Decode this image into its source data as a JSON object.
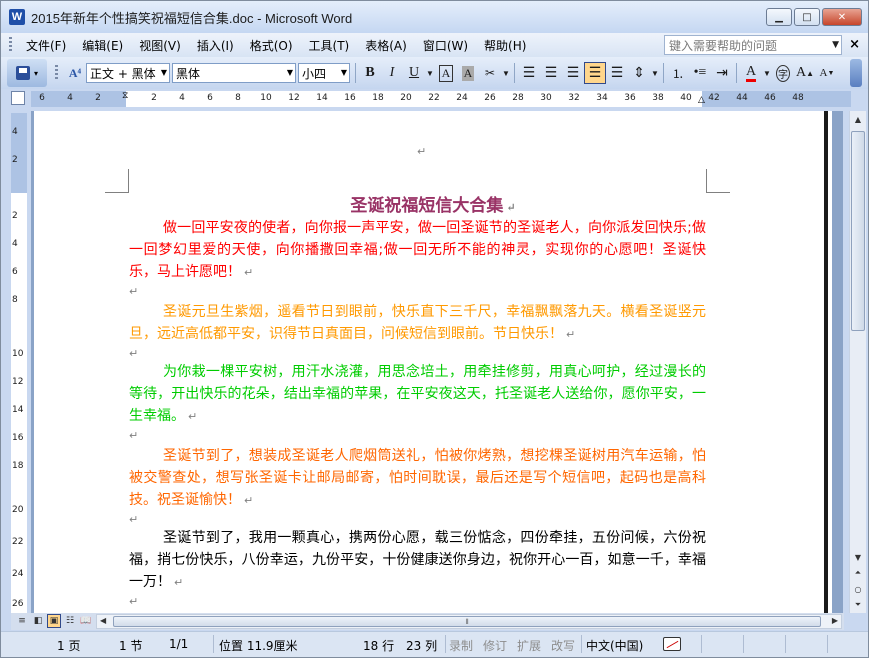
{
  "window": {
    "title": "2015年新年个性搞笑祝福短信合集.doc - Microsoft Word",
    "app_icon": "W",
    "controls": {
      "minimize_icon": "minimize-icon",
      "maximize_icon": "maximize-icon",
      "close_icon": "close-icon"
    }
  },
  "menu": {
    "items": [
      "文件(F)",
      "编辑(E)",
      "视图(V)",
      "插入(I)",
      "格式(O)",
      "工具(T)",
      "表格(A)",
      "窗口(W)",
      "帮助(H)"
    ],
    "help_placeholder": "键入需要帮助的问题",
    "doc_close": "×"
  },
  "toolbar": {
    "style_value": "正文 + 黑体",
    "font_value": "黑体",
    "size_value": "小四",
    "bold": "B",
    "italic": "I",
    "underline": "U",
    "char_border": "A",
    "char_shading": "A",
    "font_color": "A",
    "phonetic": "字",
    "grow_font": "A",
    "shrink_font": "A"
  },
  "ruler": {
    "horizontal": [
      "6",
      "4",
      "2",
      "2",
      "4",
      "6",
      "8",
      "10",
      "12",
      "14",
      "16",
      "18",
      "20",
      "22",
      "24",
      "26",
      "28",
      "30",
      "32",
      "34",
      "36",
      "38",
      "40",
      "42",
      "44",
      "46",
      "48"
    ],
    "vertical": [
      "4",
      "2",
      "2",
      "4",
      "6",
      "8",
      "10",
      "12",
      "14",
      "16",
      "18",
      "20",
      "22",
      "24",
      "26"
    ]
  },
  "document": {
    "title": "圣诞祝福短信大合集",
    "paragraph_mark": "↵",
    "paragraphs": [
      {
        "text": "做一回平安夜的使者，向你报一声平安，做一回圣诞节的圣诞老人，向你派发回快乐;做一回梦幻里爱的天使，向你播撒回幸福;做一回无所不能的神灵，实现你的心愿吧！圣诞快乐，马上许愿吧！",
        "color": "#ff0000"
      },
      {
        "text": "圣诞元旦生紫烟，遥看节日到眼前，快乐直下三千尺，幸福飘飘落九天。横看圣诞竖元旦，远近高低都平安，识得节日真面目，问候短信到眼前。节日快乐！",
        "color": "#ff9900"
      },
      {
        "text": "为你栽一棵平安树，用汗水浇灌，用思念培土，用牵挂修剪，用真心呵护，经过漫长的等待，开出快乐的花朵，结出幸福的苹果，在平安夜这天，托圣诞老人送给你，愿你平安，一生幸福。",
        "color": "#00cc00"
      },
      {
        "text": "圣诞节到了，想装成圣诞老人爬烟筒送礼，怕被你烤熟，想挖棵圣诞树用汽车运输，怕被交警查处，想写张圣诞卡让邮局邮寄，怕时间耽误，最后还是写个短信吧，起码也是高科技。祝圣诞愉快！",
        "color": "#ff6600"
      },
      {
        "text": "圣诞节到了，我用一颗真心，携两份心愿，载三份惦念，四份牵挂，五份问候，六份祝福，捎七份快乐，八份幸运，九份平安，十份健康送你身边，祝你开心一百，如意一千，幸福一万！",
        "color": "#000000"
      }
    ]
  },
  "statusbar": {
    "page": "1 页",
    "section": "1 节",
    "page_of": "1/1",
    "position": "位置 11.9厘米",
    "line": "18 行",
    "column": "23 列",
    "rec": "录制",
    "trk": "修订",
    "ext": "扩展",
    "ovr": "改写",
    "language": "中文(中国)"
  }
}
